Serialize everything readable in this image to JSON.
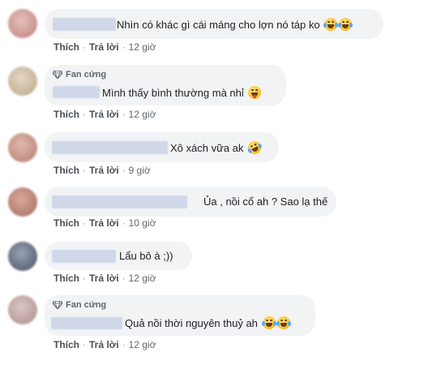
{
  "comments": [
    {
      "text": "Nhìn có khác gì cái máng cho lợn nó táp ko",
      "emojis": [
        "tears-of-joy",
        "tears-of-joy"
      ],
      "like": "Thích",
      "reply": "Trả lời",
      "time": "12 giờ",
      "avatar_color": "#d7a9a6"
    },
    {
      "badge": "Fan cứng",
      "text": "Mình thấy bình thường mà nhỉ",
      "emojis": [
        "tongue"
      ],
      "like": "Thích",
      "reply": "Trả lời",
      "time": "12 giờ",
      "avatar_color": "#cdbba0"
    },
    {
      "text": "Xô xách vữa ak",
      "emojis": [
        "rofl"
      ],
      "like": "Thích",
      "reply": "Trả lời",
      "time": "9 giờ",
      "avatar_color": "#c59488"
    },
    {
      "text": "Ủa , nồi cổ ah ? Sao lạ thế",
      "emojis": [],
      "like": "Thích",
      "reply": "Trả lời",
      "time": "10 giờ",
      "avatar_color": "#b78a7e"
    },
    {
      "text": "Lẩu bô à ;))",
      "emojis": [],
      "like": "Thích",
      "reply": "Trả lời",
      "time": "12 giờ",
      "avatar_color": "#6a7284"
    },
    {
      "badge": "Fan cứng",
      "text": "Quả nồi thời nguyên thuỷ ah",
      "emojis": [
        "tears-of-joy",
        "tears-of-joy"
      ],
      "like": "Thích",
      "reply": "Trả lời",
      "time": "12 giờ",
      "avatar_color": "#c1a6a4"
    }
  ]
}
